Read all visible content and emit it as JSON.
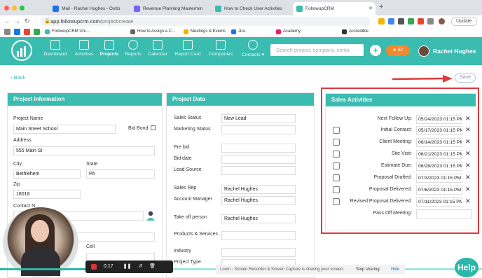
{
  "browser": {
    "tabs": [
      {
        "title": "Mail - Rachel Hughes - Outlo",
        "color": "#1a73e8"
      },
      {
        "title": "Revenue Planning Mastermin",
        "color": "#7b61ff"
      },
      {
        "title": "How to Check User Activities",
        "color": "#3bbcb0"
      },
      {
        "title": "FollowupCRM",
        "color": "#3bbcb0"
      }
    ],
    "url_host": "app.followupcrm.com",
    "url_path": "/project/create",
    "bookmarks": [
      "FollowupCRM Uni...",
      "How to Assign a C...",
      "Meetings & Events",
      "Jira",
      "Academy",
      "Accredible"
    ],
    "update_label": "Update"
  },
  "header": {
    "nav": [
      {
        "label": "Dashboard",
        "icon": "chart-icon"
      },
      {
        "label": "Activities",
        "icon": "list-icon"
      },
      {
        "label": "Projects",
        "icon": "folder-icon"
      },
      {
        "label": "Reports",
        "icon": "target-icon"
      },
      {
        "label": "Calendar",
        "icon": "calendar-icon"
      },
      {
        "label": "Report Card",
        "icon": "card-icon"
      },
      {
        "label": "Companies",
        "icon": "building-icon"
      },
      {
        "label": "Contacts",
        "icon": "person-icon"
      }
    ],
    "search_placeholder": "Search project, company, conta",
    "notif_count": "32",
    "user_name": "Rachel Hughes"
  },
  "page": {
    "back_label": "Back",
    "save_label": "Save"
  },
  "project_info": {
    "title": "Project Information",
    "name_label": "Project Name",
    "name_value": "Main Street School",
    "bid_bond_label": "Bid Bond",
    "address_label": "Address",
    "address_value": "555 Main St",
    "city_label": "City",
    "city_value": "Bethlehem",
    "state_label": "State",
    "state_value": "PA",
    "zip_label": "Zip",
    "zip_value": "18018",
    "contact_label": "Contact N",
    "cell_label": "Cell"
  },
  "project_data": {
    "title": "Project Data",
    "rows": [
      {
        "label": "Sales Status",
        "value": "New Lead"
      },
      {
        "label": "Marketing Status",
        "value": ""
      },
      {
        "label": "Pre bid",
        "value": ""
      },
      {
        "label": "Bid date",
        "value": ""
      },
      {
        "label": "Lead Source",
        "value": ""
      },
      {
        "label": "Sales Rep",
        "value": "Rachel Hughes"
      },
      {
        "label": "Account Manager",
        "value": "Rachel Hughes"
      },
      {
        "label": "Take off person",
        "value": "Rachel Hughes"
      },
      {
        "label": "Products & Services",
        "value": ""
      },
      {
        "label": "Industry",
        "value": ""
      },
      {
        "label": "Project Type",
        "value": ""
      }
    ]
  },
  "sales_activities": {
    "title": "Sales Activities",
    "rows": [
      {
        "label": "Next Follow Up:",
        "value": "05/24/2023 01:15 PM",
        "checkbox": false
      },
      {
        "label": "Initial Contact:",
        "value": "05/17/2023 01:15 PM",
        "checkbox": true
      },
      {
        "label": "Client Meeting:",
        "value": "06/14/2023 01:15 PM",
        "checkbox": true
      },
      {
        "label": "Site Visit:",
        "value": "06/21/2023 01:15 PM",
        "checkbox": true
      },
      {
        "label": "Estimate Due:",
        "value": "06/28/2023 01:15 PM",
        "checkbox": true
      },
      {
        "label": "Proposal Drafted:",
        "value": "07/3/2023 01:15 PM",
        "checkbox": true
      },
      {
        "label": "Proposal Delivered:",
        "value": "07/6/2023 01:15 PM",
        "checkbox": true
      },
      {
        "label": "Revised Proposal Delivered:",
        "value": "07/11/2023 01:15 PM",
        "checkbox": true
      },
      {
        "label": "Pass Off Meeting:",
        "value": "",
        "checkbox": false
      }
    ]
  },
  "recorder": {
    "time": "0:17",
    "share_text": "Loom - Screen Recorder & Screen Capture is sharing your screen.",
    "stop_label": "Stop sharing",
    "hide_label": "Hide"
  },
  "help_label": "Help",
  "colors": {
    "brand": "#3bbcb0",
    "highlight": "#e0393e"
  }
}
